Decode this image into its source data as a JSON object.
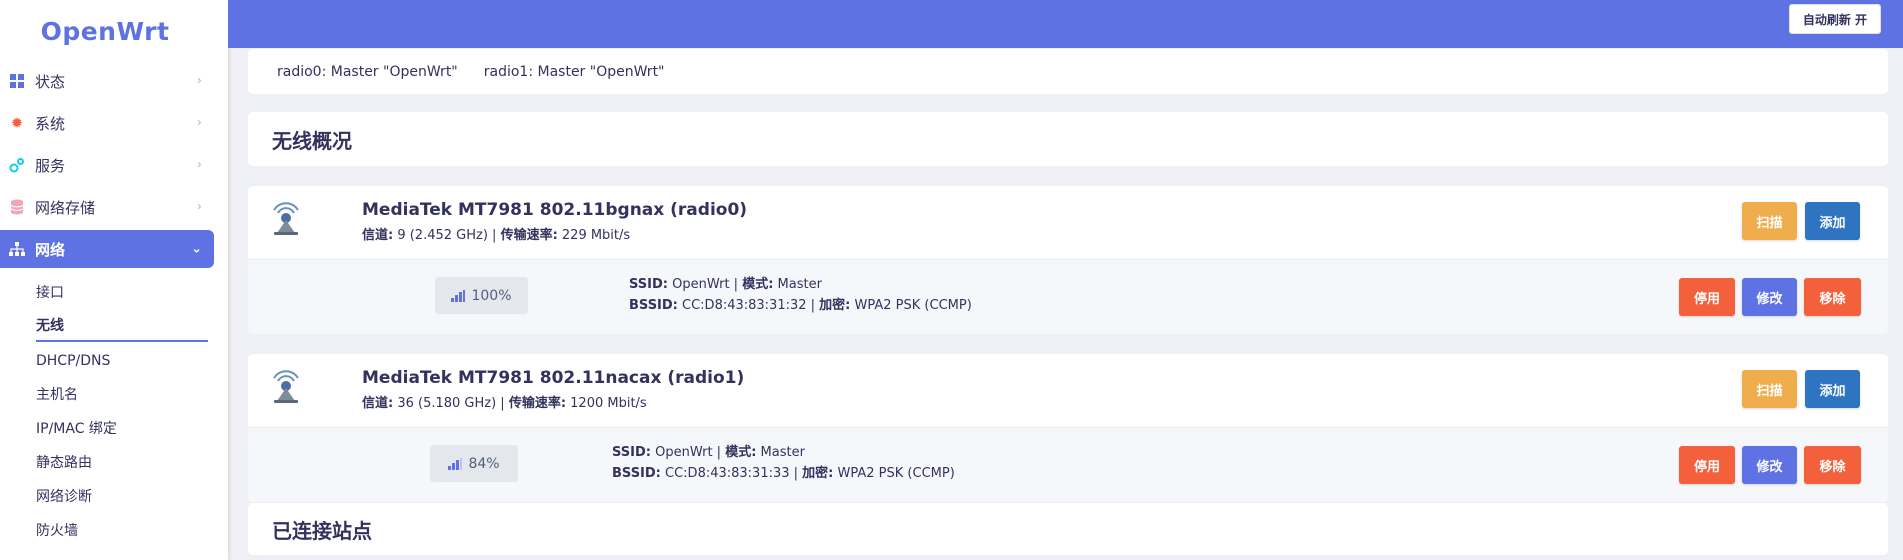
{
  "app": {
    "logo": "OpenWrt",
    "accent": "#5e72e4"
  },
  "header": {
    "refresh_label": "自动刷新 开"
  },
  "sidebar": {
    "items": [
      {
        "label": "状态",
        "icon": "dashboard-icon"
      },
      {
        "label": "系统",
        "icon": "gear-icon"
      },
      {
        "label": "服务",
        "icon": "cogs-icon"
      },
      {
        "label": "网络存储",
        "icon": "database-icon"
      },
      {
        "label": "网络",
        "icon": "sitemap-icon",
        "active": true
      }
    ],
    "subitems": [
      "接口",
      "无线",
      "DHCP/DNS",
      "主机名",
      "IP/MAC 绑定",
      "静态路由",
      "网络诊断",
      "防火墙"
    ],
    "active_subitem": "无线"
  },
  "tabs": [
    "radio0: Master \"OpenWrt\"",
    "radio1: Master \"OpenWrt\""
  ],
  "overview_title": "无线概况",
  "radios": [
    {
      "name": "MediaTek MT7981 802.11bgnax (radio0)",
      "channel_label": "信道:",
      "channel_value": " 9 (2.452 GHz) | ",
      "rate_label": "传输速率:",
      "rate_value": " 229 Mbit/s",
      "scan_label": "扫描",
      "add_label": "添加",
      "signal": "100%",
      "ssid_label": "SSID:",
      "ssid_value": " OpenWrt | ",
      "mode_label": "模式:",
      "mode_value": " Master",
      "bssid_label": "BSSID:",
      "bssid_value": " CC:D8:43:83:31:32 | ",
      "enc_label": "加密:",
      "enc_value": " WPA2 PSK (CCMP)",
      "disable_label": "停用",
      "edit_label": "修改",
      "remove_label": "移除"
    },
    {
      "name": "MediaTek MT7981 802.11nacax (radio1)",
      "channel_label": "信道:",
      "channel_value": " 36 (5.180 GHz) | ",
      "rate_label": "传输速率:",
      "rate_value": " 1200 Mbit/s",
      "scan_label": "扫描",
      "add_label": "添加",
      "signal": "84%",
      "ssid_label": "SSID:",
      "ssid_value": " OpenWrt | ",
      "mode_label": "模式:",
      "mode_value": " Master",
      "bssid_label": "BSSID:",
      "bssid_value": " CC:D8:43:83:31:33 | ",
      "enc_label": "加密:",
      "enc_value": " WPA2 PSK (CCMP)",
      "disable_label": "停用",
      "edit_label": "修改",
      "remove_label": "移除"
    }
  ],
  "stations_title": "已连接站点"
}
